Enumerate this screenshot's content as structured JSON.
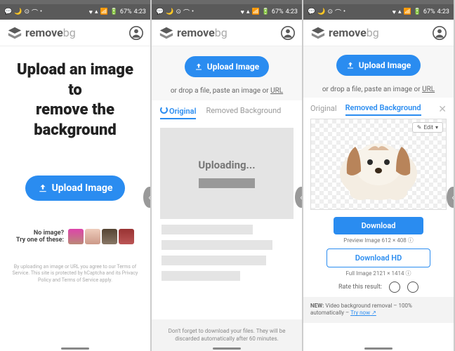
{
  "statusbar": {
    "battery": "67%",
    "time": "4:23"
  },
  "brand": {
    "name": "remove",
    "suffix": "bg"
  },
  "screen1": {
    "headline_l1": "Upload an image to",
    "headline_l2": "remove the background",
    "upload_label": "Upload Image",
    "no_image_l1": "No image?",
    "no_image_l2": "Try one of these:",
    "legal": "By uploading an image or URL you agree to our Terms of Service. This site is protected by hCaptcha and its Privacy Policy and Terms of Service apply."
  },
  "screen2": {
    "upload_label": "Upload Image",
    "drop_text": "or drop a file, paste an image or ",
    "url_label": "URL",
    "tab_original": "Original",
    "tab_removed": "Removed Background",
    "uploading": "Uploading...",
    "notice": "Don't forget to download your files. They will be discarded automatically after 60 minutes."
  },
  "screen3": {
    "upload_label": "Upload Image",
    "drop_text": "or drop a file, paste an image or ",
    "url_label": "URL",
    "tab_original": "Original",
    "tab_removed": "Removed Background",
    "edit_label": "Edit",
    "download_label": "Download",
    "preview_dim": "Preview Image 612 × 408",
    "download_hd_label": "Download HD",
    "full_dim": "Full Image 2121 × 1414",
    "rate_label": "Rate this result:",
    "new_prefix": "NEW:",
    "new_text": " Video background removal – 100% automatically – ",
    "try_now": "Try now"
  }
}
